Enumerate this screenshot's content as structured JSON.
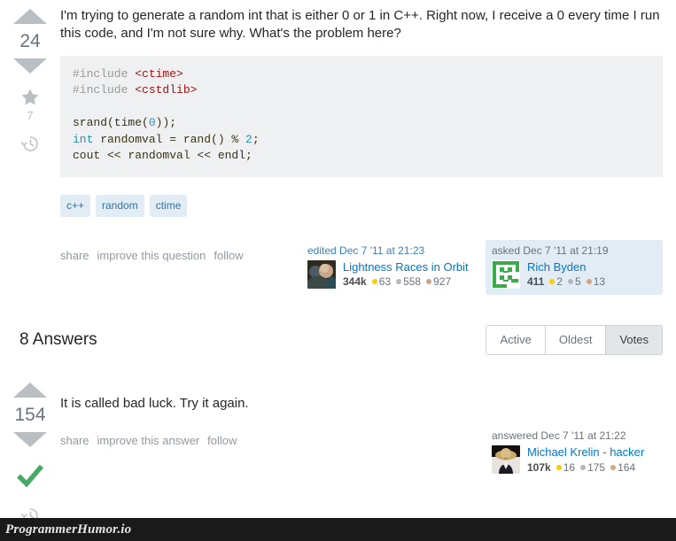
{
  "colors": {
    "accent_link": "#0077cc",
    "tag_bg": "#e1ecf4",
    "tag_text": "#39739d",
    "code_bg": "#eff0f1",
    "arrow": "#babfc4",
    "accepted_check": "#48a868",
    "badge_gold": "#ffcc01",
    "badge_silver": "#b4b8bc",
    "badge_bronze": "#d1a684",
    "watermark_bg": "#1a1a1a"
  },
  "question": {
    "votes": "24",
    "bookmark_count": "7",
    "body": "I'm trying to generate a random int that is either 0 or 1 in C++. Right now, I receive a 0 every time I run this code, and I'm not sure why. What's the problem here?",
    "code": {
      "line1_pre": "#include ",
      "line1_inc": "<ctime>",
      "line2_pre": "#include ",
      "line2_inc": "<cstdlib>",
      "line4": "srand(time(",
      "line4_num": "0",
      "line4_end": "));",
      "line5_kw": "int",
      "line5_mid": " randomval = rand() % ",
      "line5_num": "2",
      "line5_end": ";",
      "line6": "cout << randomval << endl;"
    },
    "tags": [
      "c++",
      "random",
      "ctime"
    ],
    "menu": [
      "share",
      "improve this question",
      "follow"
    ],
    "editor_card": {
      "action_link": "edited",
      "action_time": "Dec 7 '11 at 21:23",
      "name": "Lightness Races in Orbit",
      "reputation": "344k",
      "gold": "63",
      "silver": "558",
      "bronze": "927"
    },
    "asker_card": {
      "action_link": "asked",
      "action_time": "Dec 7 '11 at 21:19",
      "name": "Rich Byden",
      "reputation": "411",
      "gold": "2",
      "silver": "5",
      "bronze": "13"
    }
  },
  "answers_section": {
    "title": "8 Answers",
    "sort_tabs": [
      {
        "label": "Active",
        "active": false
      },
      {
        "label": "Oldest",
        "active": false
      },
      {
        "label": "Votes",
        "active": true
      }
    ]
  },
  "answer": {
    "votes": "154",
    "body": "It is called bad luck. Try it again.",
    "menu": [
      "share",
      "improve this answer",
      "follow"
    ],
    "answerer_card": {
      "action_link": "answered",
      "action_time": "Dec 7 '11 at 21:22",
      "name": "Michael Krelin - hacker",
      "reputation": "107k",
      "gold": "16",
      "silver": "175",
      "bronze": "164"
    }
  },
  "watermark": {
    "text": "ProgrammerHumor.io"
  }
}
